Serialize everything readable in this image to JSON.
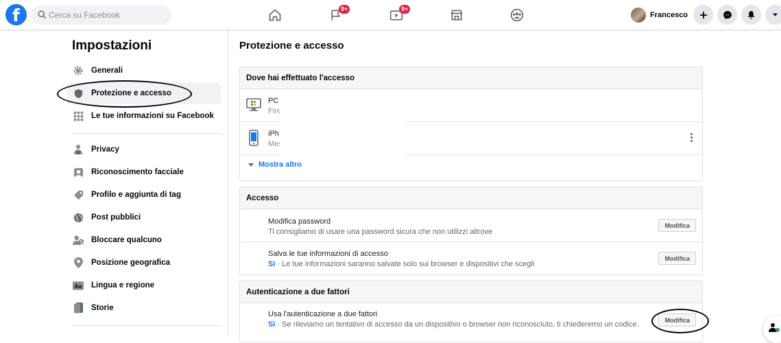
{
  "header": {
    "search_placeholder": "Cerca su Facebook",
    "nav": [
      {
        "icon": "home-icon"
      },
      {
        "icon": "flag-icon",
        "badge": "9+"
      },
      {
        "icon": "watch-icon",
        "badge": "9+"
      },
      {
        "icon": "marketplace-icon"
      },
      {
        "icon": "groups-icon"
      }
    ],
    "profile_name": "Francesco",
    "badge_color": "#e41e3f",
    "brand_color": "#1877f2"
  },
  "sidebar": {
    "title": "Impostazioni",
    "items": [
      {
        "label": "Generali",
        "icon": "gear-icon"
      },
      {
        "label": "Protezione e accesso",
        "icon": "shield-icon",
        "active": true
      },
      {
        "label": "Le tue informazioni su Facebook",
        "icon": "grid-icon"
      },
      {
        "label": "Privacy",
        "icon": "lock-icon"
      },
      {
        "label": "Riconoscimento facciale",
        "icon": "face-icon"
      },
      {
        "label": "Profilo e aggiunta di tag",
        "icon": "tag-icon"
      },
      {
        "label": "Post pubblici",
        "icon": "globe-icon"
      },
      {
        "label": "Bloccare qualcuno",
        "icon": "block-user-icon"
      },
      {
        "label": "Posizione geografica",
        "icon": "location-icon"
      },
      {
        "label": "Lingua e regione",
        "icon": "language-icon"
      },
      {
        "label": "Storie",
        "icon": "stories-icon"
      }
    ]
  },
  "main": {
    "title": "Protezione e accesso",
    "sessions": {
      "heading": "Dove hai effettuato l'accesso",
      "items": [
        {
          "device": "PC",
          "detail": "Fire",
          "icon": "desktop-icon"
        },
        {
          "device": "iPh",
          "detail": "Mes",
          "icon": "phone-icon"
        }
      ],
      "more_label": "Mostra altro"
    },
    "login": {
      "heading": "Accesso",
      "rows": [
        {
          "title": "Modifica password",
          "subtitle": "Ti consigliamo di usare una password sicura che non utilizzi altrove",
          "button": "Modifica"
        },
        {
          "title": "Salva le tue informazioni di accesso",
          "status": "Sì",
          "subtitle": " · Le tue informazioni saranno salvate solo sui browser e dispositivi che scegli",
          "button": "Modifica"
        }
      ]
    },
    "two_factor": {
      "heading": "Autenticazione a due fattori",
      "rows": [
        {
          "title": "Usa l'autenticazione a due fattori",
          "status": "Sì",
          "subtitle": " · Se rileviamo un tentativo di accesso da un dispositivo o browser non riconosciuto, ti chiederemo un codice.",
          "button": "Modifica"
        }
      ]
    }
  }
}
